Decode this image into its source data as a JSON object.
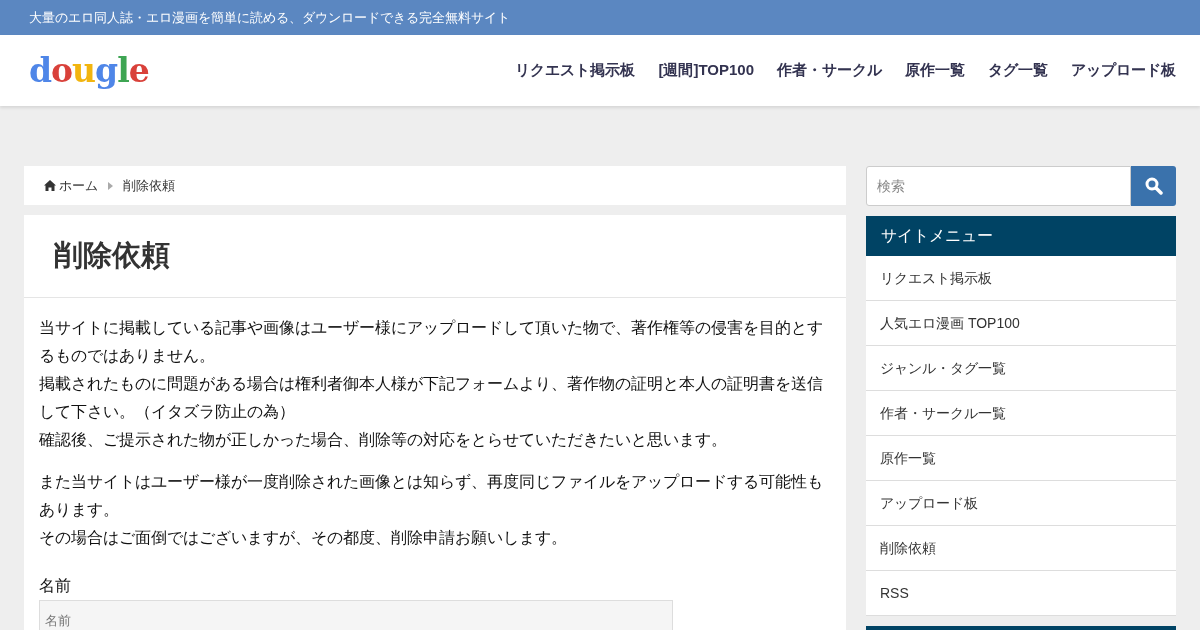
{
  "top_bar": {
    "tagline": "大量のエロ同人誌・エロ漫画を簡単に読める、ダウンロードできる完全無料サイト"
  },
  "header": {
    "logo": "dougle",
    "nav": [
      "リクエスト掲示板",
      "[週間]TOP100",
      "作者・サークル",
      "原作一覧",
      "タグ一覧",
      "アップロード板"
    ]
  },
  "breadcrumb": {
    "items": [
      "ホーム",
      "削除依頼"
    ]
  },
  "article": {
    "title": "削除依頼",
    "paragraphs": [
      [
        "当サイトに掲載している記事や画像はユーザー様にアップロードして頂いた物で、著作権等の侵害を目的とするものではありません。",
        "掲載されたものに問題がある場合は権利者御本人様が下記フォームより、著作物の証明と本人の証明書を送信して下さい。（イタズラ防止の為）",
        "確認後、ご提示された物が正しかった場合、削除等の対応をとらせていただきたいと思います。"
      ],
      [
        "また当サイトはユーザー様が一度削除された画像とは知らず、再度同じファイルをアップロードする可能性もあります。",
        "その場合はご面倒ではございますが、その都度、削除申請お願いします。"
      ]
    ],
    "form": {
      "fields": [
        {
          "label": "名前",
          "placeholder": "名前"
        }
      ]
    }
  },
  "sidebar": {
    "search": {
      "placeholder": "検索"
    },
    "menu_title": "サイトメニュー",
    "menu_items": [
      "リクエスト掲示板",
      "人気エロ漫画 TOP100",
      "ジャンル・タグ一覧",
      "作者・サークル一覧",
      "原作一覧",
      "アップロード板",
      "削除依頼",
      "RSS"
    ]
  }
}
